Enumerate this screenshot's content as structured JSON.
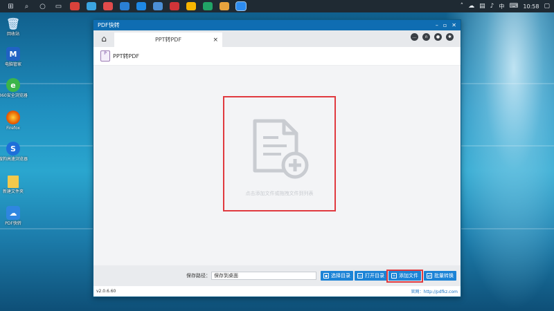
{
  "taskbar": {
    "time": "10:58",
    "ime": "中"
  },
  "desktop": {
    "icons": [
      {
        "label": "回收站",
        "icon": "recycle-bin-icon",
        "color": "#6fa8d8"
      },
      {
        "label": "电脑管家",
        "icon": "pc-manager-icon",
        "color": "#2062c4"
      },
      {
        "label": "360安全浏览器",
        "icon": "360-browser-icon",
        "color": "#3bb54a"
      },
      {
        "label": "Firefox",
        "icon": "firefox-icon",
        "color": "#e66000"
      },
      {
        "label": "搜狗高速浏览器",
        "icon": "sogou-browser-icon",
        "color": "#1e6fd9"
      },
      {
        "label": "新建文件夹",
        "icon": "folder-icon",
        "color": "#f2c94c"
      },
      {
        "label": "PDF快转",
        "icon": "pdf-cloud-icon",
        "color": "#2f86e0"
      }
    ]
  },
  "window": {
    "title": "PDF快转",
    "tab_label": "PPT转PDF",
    "subtitle": "PPT转PDF",
    "file_type_badge": "P",
    "drop_hint": "点击添加文件或拖拽文件到列表",
    "save_path_label": "保存路径：",
    "save_path_value": "保存到桌面",
    "buttons": {
      "choose_dir": "选择目录",
      "open_dir": "打开目录",
      "add_file": "添加文件",
      "batch_convert": "批量转换"
    },
    "version": "v2.0.6.60",
    "website": "官网：http://pdfkz.com"
  },
  "colors": {
    "accent": "#1b83d6",
    "highlight": "#e0393e",
    "titlebar": "#0f6db2"
  }
}
